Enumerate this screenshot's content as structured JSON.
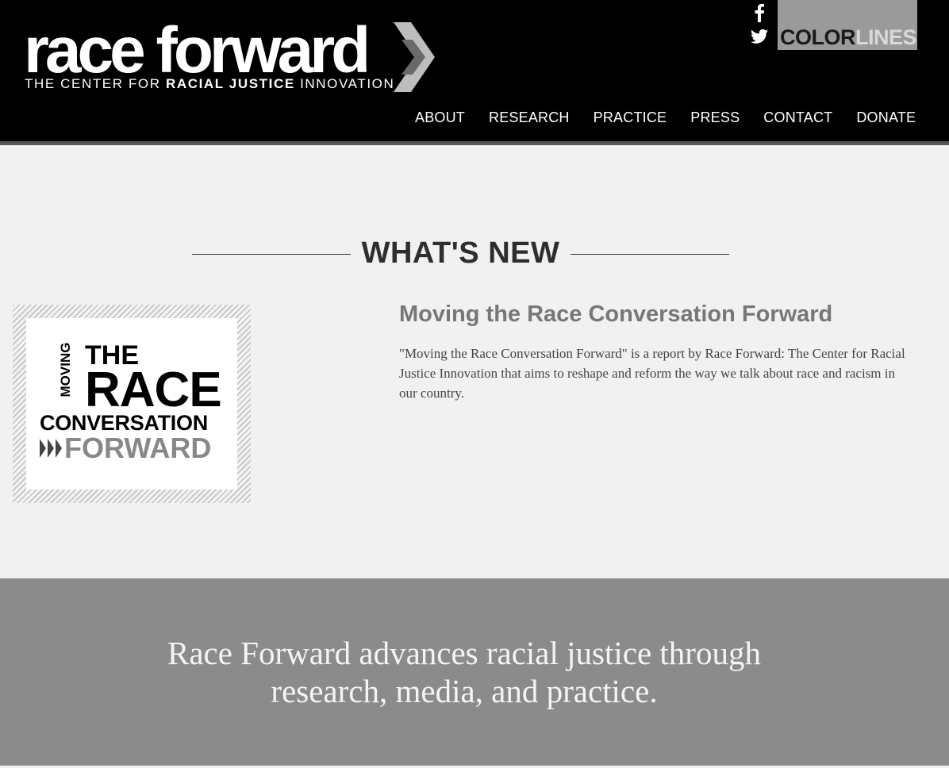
{
  "header": {
    "logo_word": "race forward",
    "tagline_pre": "THE CENTER FOR ",
    "tagline_bold": "RACIAL JUSTICE",
    "tagline_post": " INNOVATION",
    "colorlines_a": "COLOR",
    "colorlines_b": "LINES",
    "social": [
      {
        "icon": "facebook-icon",
        "glyph": "f"
      },
      {
        "icon": "twitter-icon",
        "glyph": "t"
      }
    ],
    "nav": [
      "ABOUT",
      "RESEARCH",
      "PRACTICE",
      "PRESS",
      "CONTACT",
      "DONATE"
    ]
  },
  "whats_new": {
    "heading": "WHAT'S NEW",
    "image": {
      "moving": "MOVING",
      "the": "THE",
      "race": "RACE",
      "conversation": "CONVERSATION",
      "forward": "FORWARD"
    },
    "title": "Moving the Race Conversation Forward",
    "description": "\"Moving the Race Conversation Forward\" is a report by Race Forward: The Center for Racial Justice Innovation that aims to reshape and reform the way we talk about race and racism in our country."
  },
  "band": {
    "text": "Race Forward advances racial justice through research, media, and practice."
  },
  "colors": {
    "header_bg": "#000000",
    "page_bg": "#f1f1f1",
    "band_bg": "#8b8b8b",
    "title_gray": "#777777"
  }
}
